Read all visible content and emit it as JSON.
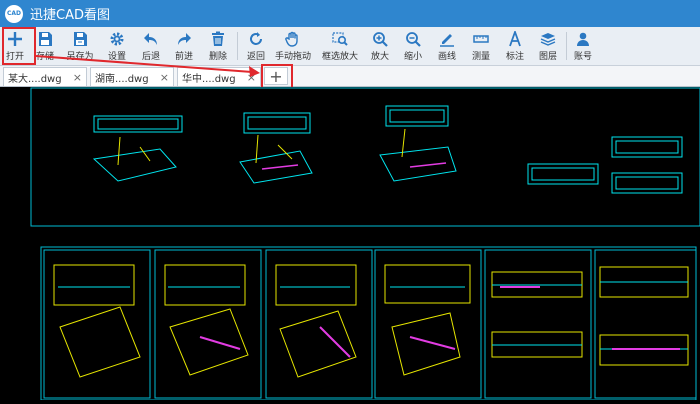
{
  "app": {
    "title": "迅捷CAD看图",
    "logo": "CAD"
  },
  "toolbar": {
    "buttons": [
      {
        "label": "打开",
        "icon": "plus-icon"
      },
      {
        "label": "存储",
        "icon": "save-icon"
      },
      {
        "label": "另存为",
        "icon": "save-as-icon"
      },
      {
        "label": "设置",
        "icon": "gear-icon"
      },
      {
        "label": "后退",
        "icon": "undo-icon"
      },
      {
        "label": "前进",
        "icon": "redo-icon"
      },
      {
        "label": "删除",
        "icon": "trash-icon"
      },
      {
        "label": "返回",
        "icon": "return-icon"
      },
      {
        "label": "手动拖动",
        "icon": "hand-icon"
      },
      {
        "label": "框选放大",
        "icon": "box-zoom-icon"
      },
      {
        "label": "放大",
        "icon": "zoom-in-icon"
      },
      {
        "label": "缩小",
        "icon": "zoom-out-icon"
      },
      {
        "label": "画线",
        "icon": "pen-icon"
      },
      {
        "label": "测量",
        "icon": "ruler-icon"
      },
      {
        "label": "标注",
        "icon": "text-a-icon"
      },
      {
        "label": "图层",
        "icon": "layers-icon"
      },
      {
        "label": "账号",
        "icon": "user-icon"
      }
    ]
  },
  "tabs": [
    {
      "name": "某大....dwg",
      "close": "×"
    },
    {
      "name": "湖南....dwg",
      "close": "×"
    },
    {
      "name": "华中....dwg",
      "close": "×"
    }
  ],
  "add_tab": "+",
  "colors": {
    "titlebar": "#2f86cf",
    "toolbar": "#e9eef4",
    "icon_blue": "#2b78c2",
    "highlight": "#e0282d",
    "cad_cyan": "#00e5ee",
    "cad_yellow": "#e6e600",
    "cad_magenta": "#e23ce2",
    "canvas": "#000000"
  }
}
